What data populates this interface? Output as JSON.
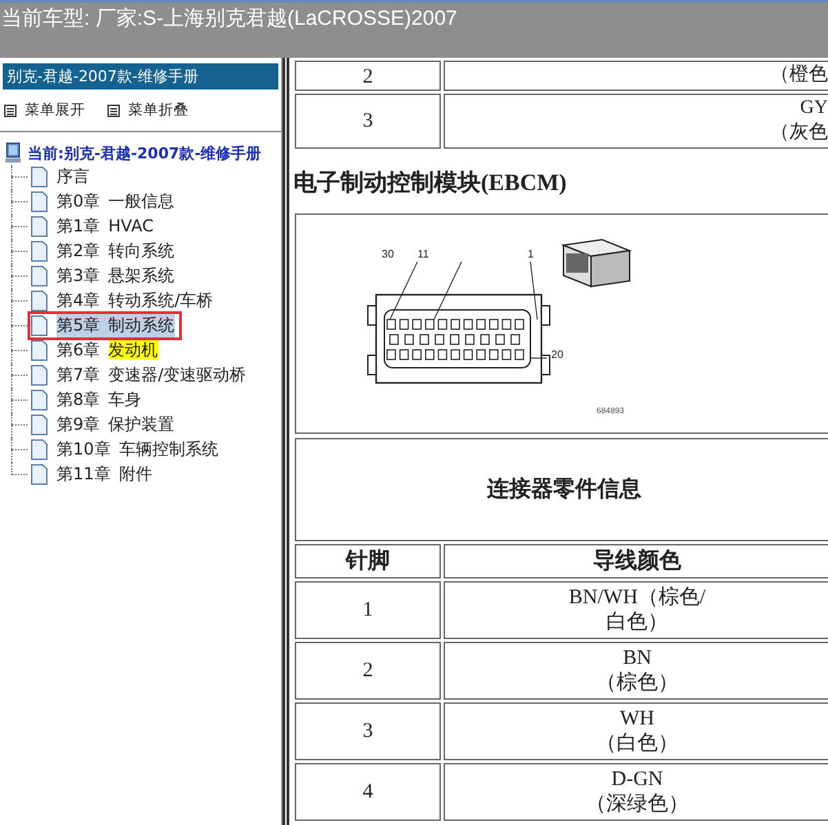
{
  "window": {
    "title": "当前车型:  厂家:S-上海别克君越(LaCROSSE)2007"
  },
  "sidebar": {
    "header": "别克-君越-2007款-维修手册",
    "menu_actions": [
      {
        "label": "菜单展开"
      },
      {
        "label": "菜单折叠"
      }
    ],
    "tree": {
      "label": "当前:别克-君越-2007款-维修手册",
      "children": [
        {
          "title": "序言",
          "selected": false,
          "highlighted": false
        },
        {
          "chapter": "第0章",
          "title": "一般信息",
          "selected": false,
          "highlighted": false
        },
        {
          "chapter": "第1章",
          "title": "HVAC",
          "selected": false,
          "highlighted": false
        },
        {
          "chapter": "第2章",
          "title": "转向系统",
          "selected": false,
          "highlighted": false
        },
        {
          "chapter": "第3章",
          "title": "悬架系统",
          "selected": false,
          "highlighted": false
        },
        {
          "chapter": "第4章",
          "title": "转动系统/车桥",
          "selected": false,
          "highlighted": false
        },
        {
          "chapter": "第5章",
          "title": "制动系统",
          "selected": true,
          "highlighted": false
        },
        {
          "chapter": "第6章",
          "title": "发动机",
          "selected": false,
          "highlighted": true
        },
        {
          "chapter": "第7章",
          "title": "变速器/变速驱动桥",
          "selected": false,
          "highlighted": false
        },
        {
          "chapter": "第8章",
          "title": "车身",
          "selected": false,
          "highlighted": false
        },
        {
          "chapter": "第9章",
          "title": "保护装置",
          "selected": false,
          "highlighted": false
        },
        {
          "chapter": "第10章",
          "title": "车辆控制系统",
          "selected": false,
          "highlighted": false
        },
        {
          "chapter": "第11章",
          "title": "附件",
          "selected": false,
          "highlighted": false
        }
      ]
    }
  },
  "content": {
    "previous_table_rows": [
      {
        "pin": "2",
        "color_lines": [
          "（橙色"
        ]
      },
      {
        "pin": "3",
        "color_lines": [
          "GY",
          "（灰色"
        ]
      }
    ],
    "heading": "电子制动控制模块(EBCM)",
    "diagram": {
      "callouts": [
        "30",
        "11",
        "1",
        "20"
      ],
      "figure_number": "684893"
    },
    "connector_info_title": "连接器零件信息",
    "table": {
      "columns": [
        "针脚",
        "导线颜色"
      ],
      "rows": [
        {
          "pin": "1",
          "color_lines": [
            "BN/WH（棕色/",
            "白色）"
          ]
        },
        {
          "pin": "2",
          "color_lines": [
            "BN",
            "（棕色）"
          ]
        },
        {
          "pin": "3",
          "color_lines": [
            "WH",
            "（白色）"
          ]
        },
        {
          "pin": "4",
          "color_lines": [
            "D-GN",
            "（深绿色）"
          ]
        }
      ]
    }
  }
}
